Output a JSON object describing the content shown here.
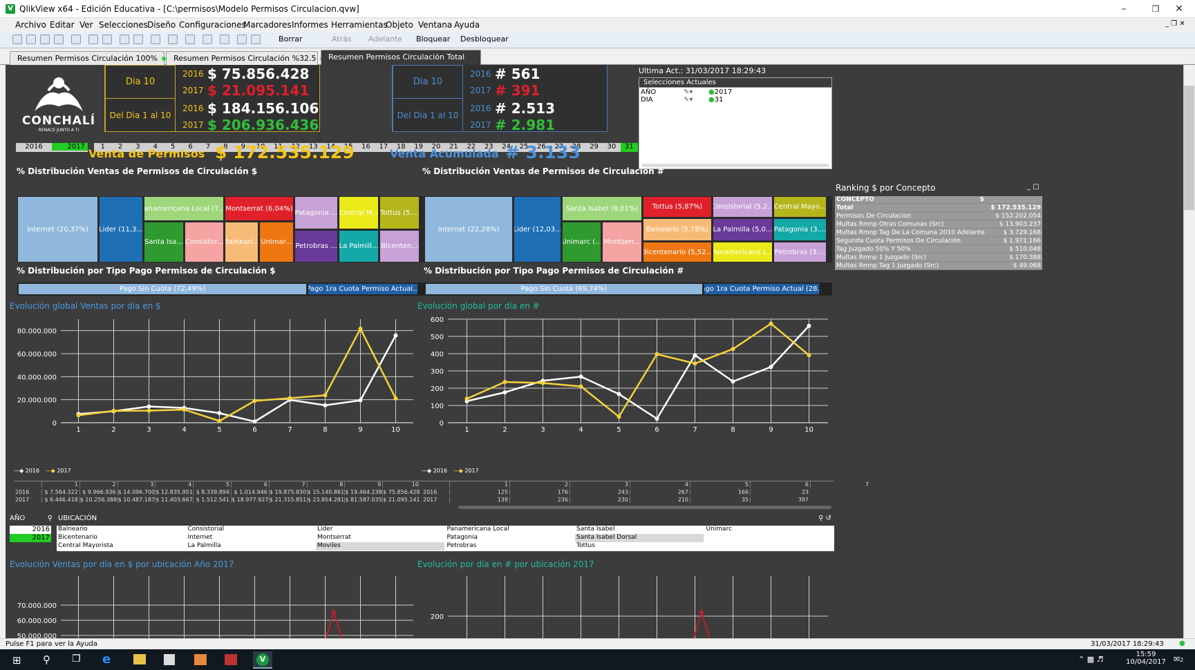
{
  "window": {
    "title": "QlikView x64 - Edición Educativa - [C:\\permisos\\Modelo Permisos Circulacion.qvw]",
    "app_icon": "V"
  },
  "menu": [
    "Archivo",
    "Editar",
    "Ver",
    "Selecciones",
    "Diseño",
    "Configuraciones",
    "Marcadores",
    "Informes",
    "Herramientas",
    "Objeto",
    "Ventana",
    "Ayuda"
  ],
  "toolbar": {
    "borrar": "Borrar",
    "atras": "Atrás",
    "adelante": "Adelante",
    "bloquear": "Bloquear",
    "desbloquear": "Desbloquear"
  },
  "tabs": [
    {
      "label": "Resumen Permisos Circulación 100%"
    },
    {
      "label": "Resumen Permisos Circulación %32.5"
    },
    {
      "label": "Resumen Permisos Circulación Total"
    }
  ],
  "logo": {
    "name": "CONCHALÍ",
    "tagline": "RENACE JUNTO A TI"
  },
  "kpi_money": {
    "dia_label": "Dia 10",
    "range_label": "Del Dia 1 al 10",
    "y2016": "2016",
    "y2017": "2017",
    "dia_2016": "$ 75.856.428",
    "dia_2017": "$ 21.095.141",
    "range_2016": "$ 184.156.106",
    "range_2017": "$ 206.936.436"
  },
  "kpi_count": {
    "dia_label": "Dia 10",
    "range_label": "Del Dia 1 al 10",
    "y2016": "2016",
    "y2017": "2017",
    "dia_2016": "# 561",
    "dia_2017": "# 391",
    "range_2016": "# 2.513",
    "range_2017": "# 2.981"
  },
  "year_filter": [
    "2016",
    "2017"
  ],
  "day_filter": [
    "1",
    "2",
    "3",
    "4",
    "5",
    "6",
    "7",
    "8",
    "9",
    "10",
    "11",
    "12",
    "13",
    "14",
    "15",
    "16",
    "17",
    "18",
    "19",
    "20",
    "21",
    "22",
    "23",
    "24",
    "25",
    "26",
    "27",
    "28",
    "29",
    "30",
    "31"
  ],
  "venta_permisos": {
    "label": "Venta de Permisos",
    "value": "$ 172.535.129"
  },
  "venta_acumulada": {
    "label": "Venta Acumulada",
    "value": "# 3.133"
  },
  "last_update": "Ultima Act.: 31/03/2017 18:29:43",
  "selections": {
    "title": "Selecciones Actuales",
    "rows": [
      {
        "field": "AÑO",
        "value": "2017"
      },
      {
        "field": "DIA",
        "value": "31"
      }
    ]
  },
  "dist_money_title": "% Distribución Ventas de Permisos de Circulación $",
  "dist_count_title": "% Distribución Ventas de Permisos de Circulación #",
  "treemap_money": [
    "Internet (20,37%)",
    "Lider (11,3...",
    "Panamericana Local (7....",
    "Montserrat (6,04%)",
    "Patagonia ...",
    "Central M...",
    "Tottus (5....",
    "Santa Isa...",
    "Consistor...",
    "Balneari...",
    "Unimar...",
    "Petrobras ...",
    "La Palmill...",
    "Bicenten..."
  ],
  "treemap_count": [
    "Internet (22,28%)",
    "Lider (12,03...",
    "Santa Isabel (8,01%)",
    "Tottus (5,87%)",
    "Consistorial (5,2...",
    "Central Mayo...",
    "Balneario (5,78%)",
    "La Palmilla (5,0...",
    "Patagonia (3....",
    "Unimarc (...",
    "Montserr...",
    "Bicentenario (5,52...",
    "Panamericana L...",
    "Petrobras (3...."
  ],
  "paytype_money_title": "% Distribución por Tipo Pago Permisos de Circulación $",
  "paytype_count_title": "% Distribución por Tipo Pago Permisos de Circulación #",
  "paytype_money": [
    "Pago Sin Cuota (72,49%)",
    "Pago 1ra Cuota Permiso Actual..."
  ],
  "paytype_count": [
    "Pago Sin Cuota (69,74%)",
    "Pago 1ra Cuota Permiso Actual (28...."
  ],
  "ranking": {
    "title": "Ranking $ por Concepto",
    "header_concept": "CONCEPTO",
    "header_value": "$",
    "rows": [
      {
        "c": "Total",
        "v": "$ 172.535.129"
      },
      {
        "c": "Permisos De Circulacion",
        "v": "$ 152.202.054"
      },
      {
        "c": "Multas Rmnp Otras Comunas (Src)",
        "v": "$ 13.903.237"
      },
      {
        "c": "Multas Rmnp Tag De La Comuna 2010 Adelante",
        "v": "$ 3.729.168"
      },
      {
        "c": "Segunda Cuota Permisos De Circulación",
        "v": "$ 1.971.166"
      },
      {
        "c": "Tag Juzgado 50% Y 50%",
        "v": "$ 510.048"
      },
      {
        "c": "Multas Rmnp 1 Juzgado (Src)",
        "v": "$ 170.388"
      },
      {
        "c": "Multas Rmnp Tag 1 Juzgado (Src)",
        "v": "$ 49.068"
      }
    ]
  },
  "chart_money_title": "Evolución global Ventas por día en $",
  "chart_count_title": "Evolución global por día en #",
  "chart_data": [
    {
      "type": "line",
      "title": "Evolución global Ventas por día en $",
      "x": [
        1,
        2,
        3,
        4,
        5,
        6,
        7,
        8,
        9,
        10
      ],
      "ylim": [
        0,
        90000000
      ],
      "yticks": [
        "0",
        "20.000.000",
        "40.000.000",
        "60.000.000",
        "80.000.000"
      ],
      "series": [
        {
          "name": "2016",
          "color": "#ffffff",
          "values": [
            7564322,
            9966936,
            14096700,
            12835951,
            8339894,
            1014946,
            19875830,
            15140861,
            19464238,
            75856428
          ]
        },
        {
          "name": "2017",
          "color": "#f5d33a",
          "values": [
            6446418,
            10256388,
            10487187,
            11403667,
            1512541,
            18977927,
            21315851,
            23854281,
            81587035,
            21095141
          ]
        }
      ]
    },
    {
      "type": "line",
      "title": "Evolución global por día en #",
      "x": [
        1,
        2,
        3,
        4,
        5,
        6,
        7,
        8,
        9,
        10
      ],
      "ylim": [
        0,
        600
      ],
      "yticks": [
        "0",
        "100",
        "200",
        "300",
        "400",
        "500",
        "600"
      ],
      "series": [
        {
          "name": "2016",
          "color": "#ffffff",
          "values": [
            125,
            176,
            243,
            267,
            166,
            23,
            391,
            239,
            323,
            561
          ]
        },
        {
          "name": "2017",
          "color": "#f5d33a",
          "values": [
            139,
            236,
            230,
            210,
            35,
            397,
            343,
            427,
            574,
            391
          ]
        }
      ]
    }
  ],
  "legend": {
    "s2016": "2016",
    "s2017": "2017"
  },
  "money_table": {
    "days": [
      "1",
      "2",
      "3",
      "4",
      "5",
      "6",
      "7",
      "8",
      "9",
      "10"
    ],
    "r2016": [
      "$ 7.564.322",
      "$ 9.966.936",
      "$ 14.096.700",
      "$ 12.835.951",
      "$ 8.339.894",
      "$ 1.014.946",
      "$ 19.875.830",
      "$ 15.140.861",
      "$ 19.464.238",
      "$ 75.856.428"
    ],
    "r2017": [
      "$ 6.446.418",
      "$ 10.256.388",
      "$ 10.487.187",
      "$ 11.403.667",
      "$ 1.512.541",
      "$ 18.977.927",
      "$ 21.315.851",
      "$ 23.854.281",
      "$ 81.587.035",
      "$ 21.095.141"
    ]
  },
  "count_table": {
    "days": [
      "1",
      "2",
      "3",
      "4",
      "5",
      "6",
      "7"
    ],
    "r2016": [
      "125",
      "176",
      "243",
      "267",
      "166",
      "23"
    ],
    "r2017": [
      "139",
      "236",
      "230",
      "210",
      "35",
      "397"
    ]
  },
  "ano_list": {
    "title": "AÑO",
    "items": [
      "2016",
      "2017"
    ]
  },
  "ubicacion": {
    "title": "UBICACIÓN",
    "cols": [
      [
        "Balneario",
        "Bicentenario",
        "Central Mayorista"
      ],
      [
        "Consistorial",
        "Internet",
        "La Palmilla"
      ],
      [
        "Lider",
        "Montserrat",
        "Moviles"
      ],
      [
        "Panamericana Local",
        "Patagonia",
        "Petrobras"
      ],
      [
        "Santa Isabel",
        "Santa Isabel Dorsal",
        "Tottus"
      ],
      [
        "Unimarc"
      ]
    ]
  },
  "chart_money_loc_title": "Evolución Ventas por día en $ por ubicación Año 2017",
  "chart_count_loc_title": "Evolución por día en # por ubicación 2017",
  "loc_money_yticks": [
    "50.000.000",
    "60.000.000",
    "70.000.000"
  ],
  "loc_count_yticks": [
    "200"
  ],
  "status": {
    "help": "Pulse F1 para ver la Ayuda",
    "datetime": "31/03/2017 18:29:43"
  },
  "taskbar": {
    "time": "15:59",
    "date": "10/04/2017",
    "notif": "2"
  },
  "colors": {
    "gold": "#f5c518",
    "red": "#e0202a",
    "green": "#2fbf3a",
    "blue": "#4a8fd8",
    "sheet": "#3c3c3c"
  }
}
